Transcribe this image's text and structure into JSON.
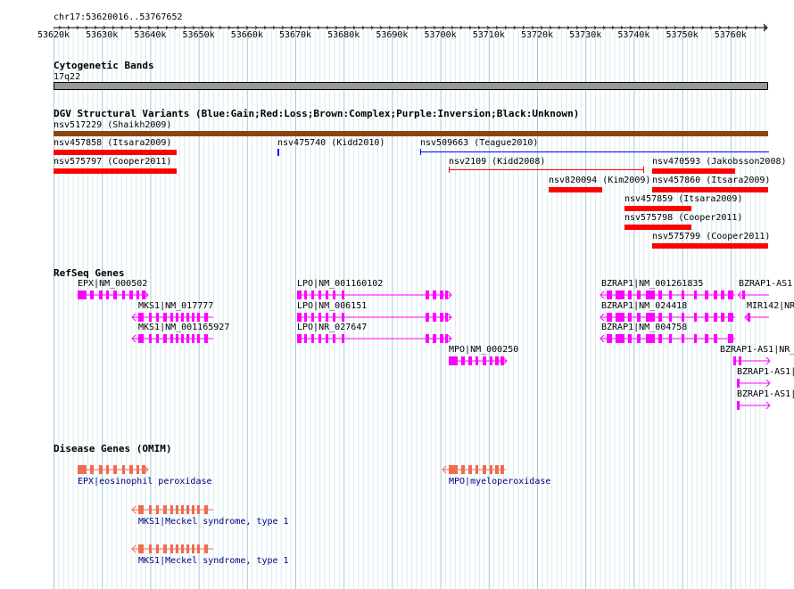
{
  "ruler": {
    "title": "chr17:53620016..53767652",
    "ticks": [
      "53620k",
      "53630k",
      "53640k",
      "53650k",
      "53660k",
      "53670k",
      "53680k",
      "53690k",
      "53700k",
      "53710k",
      "53720k",
      "53730k",
      "53740k",
      "53750k",
      "53760k"
    ]
  },
  "cytoband": {
    "title": "Cytogenetic Bands",
    "band": "17q22"
  },
  "dgv": {
    "title": "DGV Structural Variants (Blue:Gain;Red:Loss;Brown:Complex;Purple:Inversion;Black:Unknown)",
    "variants": [
      "nsv517229 (Shaikh2009)",
      "nsv457858 (Itsara2009)",
      "nsv575797 (Cooper2011)",
      "nsv475740 (Kidd2010)",
      "nsv509663 (Teague2010)",
      "nsv2109 (Kidd2008)",
      "nsv470593 (Jakobsson2008)",
      "nsv820094 (Kim2009)",
      "nsv457860 (Itsara2009)",
      "nsv457859 (Itsara2009)",
      "nsv575798 (Cooper2011)",
      "nsv575799 (Cooper2011)"
    ],
    "colors": {
      "loss": "#ff0000",
      "gain": "#0000ff",
      "complex": "#8b4513"
    }
  },
  "refseq": {
    "title": "RefSeq Genes",
    "genes": [
      "EPX|NM_000502",
      "MKS1|NM_017777",
      "MKS1|NM_001165927",
      "LPO|NM_001160102",
      "LPO|NM_006151",
      "LPO|NR_027647",
      "MPO|NM_000250",
      "BZRAP1|NM_001261835",
      "BZRAP1|NM_024418",
      "BZRAP1|NM_004758",
      "BZRAP1-AS1",
      "MIR142|NR",
      "BZRAP1-AS1|NR_",
      "BZRAP1-AS1|",
      "BZRAP1-AS1|"
    ],
    "color": "#ff00ff"
  },
  "omim": {
    "title": "Disease Genes (OMIM)",
    "genes": [
      "EPX|eosinophil peroxidase",
      "MPO|myeloperoxidase",
      "MKS1|Meckel syndrome, type 1",
      "MKS1|Meckel syndrome, type 1"
    ],
    "color": "#f26a4f",
    "label_color": "#000080"
  }
}
